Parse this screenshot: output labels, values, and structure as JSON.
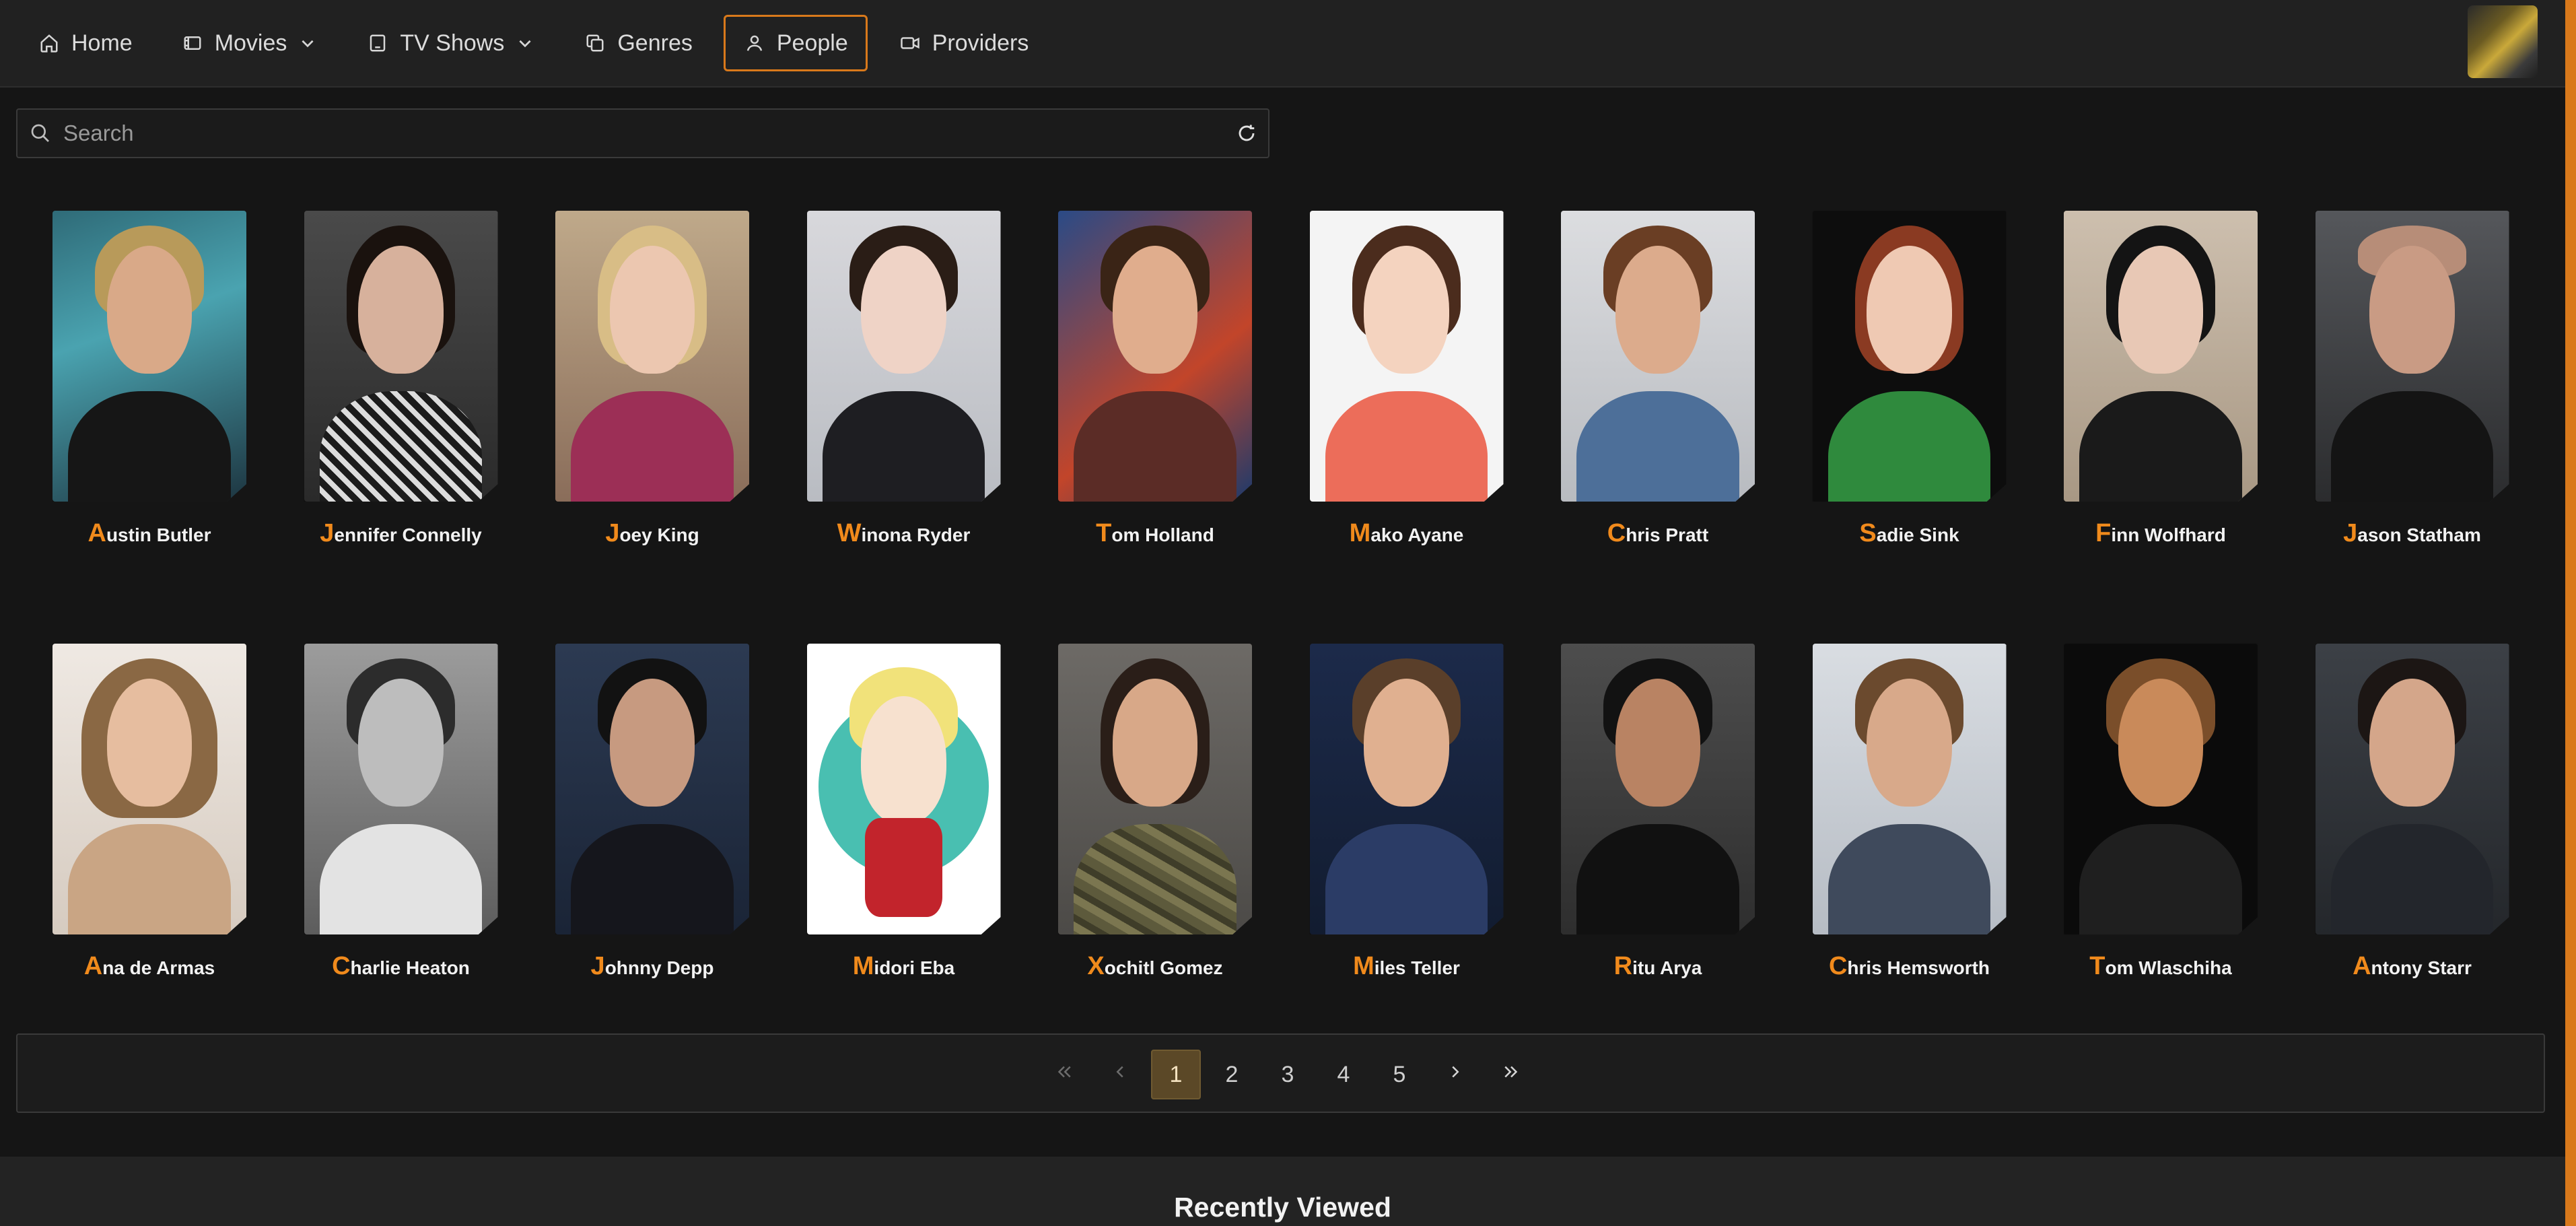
{
  "nav": {
    "items": [
      {
        "label": "Home",
        "icon": "home-icon",
        "dropdown": false,
        "active": false
      },
      {
        "label": "Movies",
        "icon": "film-icon",
        "dropdown": true,
        "active": false
      },
      {
        "label": "TV Shows",
        "icon": "tv-icon",
        "dropdown": true,
        "active": false
      },
      {
        "label": "Genres",
        "icon": "copy-icon",
        "dropdown": false,
        "active": false
      },
      {
        "label": "People",
        "icon": "person-icon",
        "dropdown": false,
        "active": true
      },
      {
        "label": "Providers",
        "icon": "video-icon",
        "dropdown": false,
        "active": false
      }
    ]
  },
  "search": {
    "placeholder": "Search",
    "value": ""
  },
  "people": [
    {
      "initial": "A",
      "rest": "ustin Butler"
    },
    {
      "initial": "J",
      "rest": "ennifer Connelly"
    },
    {
      "initial": "J",
      "rest": "oey King"
    },
    {
      "initial": "W",
      "rest": "inona Ryder"
    },
    {
      "initial": "T",
      "rest": "om Holland"
    },
    {
      "initial": "M",
      "rest": "ako Ayane"
    },
    {
      "initial": "C",
      "rest": "hris Pratt"
    },
    {
      "initial": "S",
      "rest": "adie Sink"
    },
    {
      "initial": "F",
      "rest": "inn Wolfhard"
    },
    {
      "initial": "J",
      "rest": "ason Statham"
    },
    {
      "initial": "A",
      "rest": "na de Armas"
    },
    {
      "initial": "C",
      "rest": "harlie Heaton"
    },
    {
      "initial": "J",
      "rest": "ohnny Depp"
    },
    {
      "initial": "M",
      "rest": "idori Eba"
    },
    {
      "initial": "X",
      "rest": "ochitl Gomez"
    },
    {
      "initial": "M",
      "rest": "iles Teller"
    },
    {
      "initial": "R",
      "rest": "itu Arya"
    },
    {
      "initial": "C",
      "rest": "hris Hemsworth"
    },
    {
      "initial": "T",
      "rest": "om Wlaschiha"
    },
    {
      "initial": "A",
      "rest": "ntony Starr"
    }
  ],
  "pagination": {
    "pages": [
      "1",
      "2",
      "3",
      "4",
      "5"
    ],
    "current": "1"
  },
  "recent": {
    "title": "Recently Viewed"
  },
  "colors": {
    "accent": "#f08a1c",
    "background": "#151515",
    "navbar": "#212121",
    "active_page": "#5b4827"
  }
}
